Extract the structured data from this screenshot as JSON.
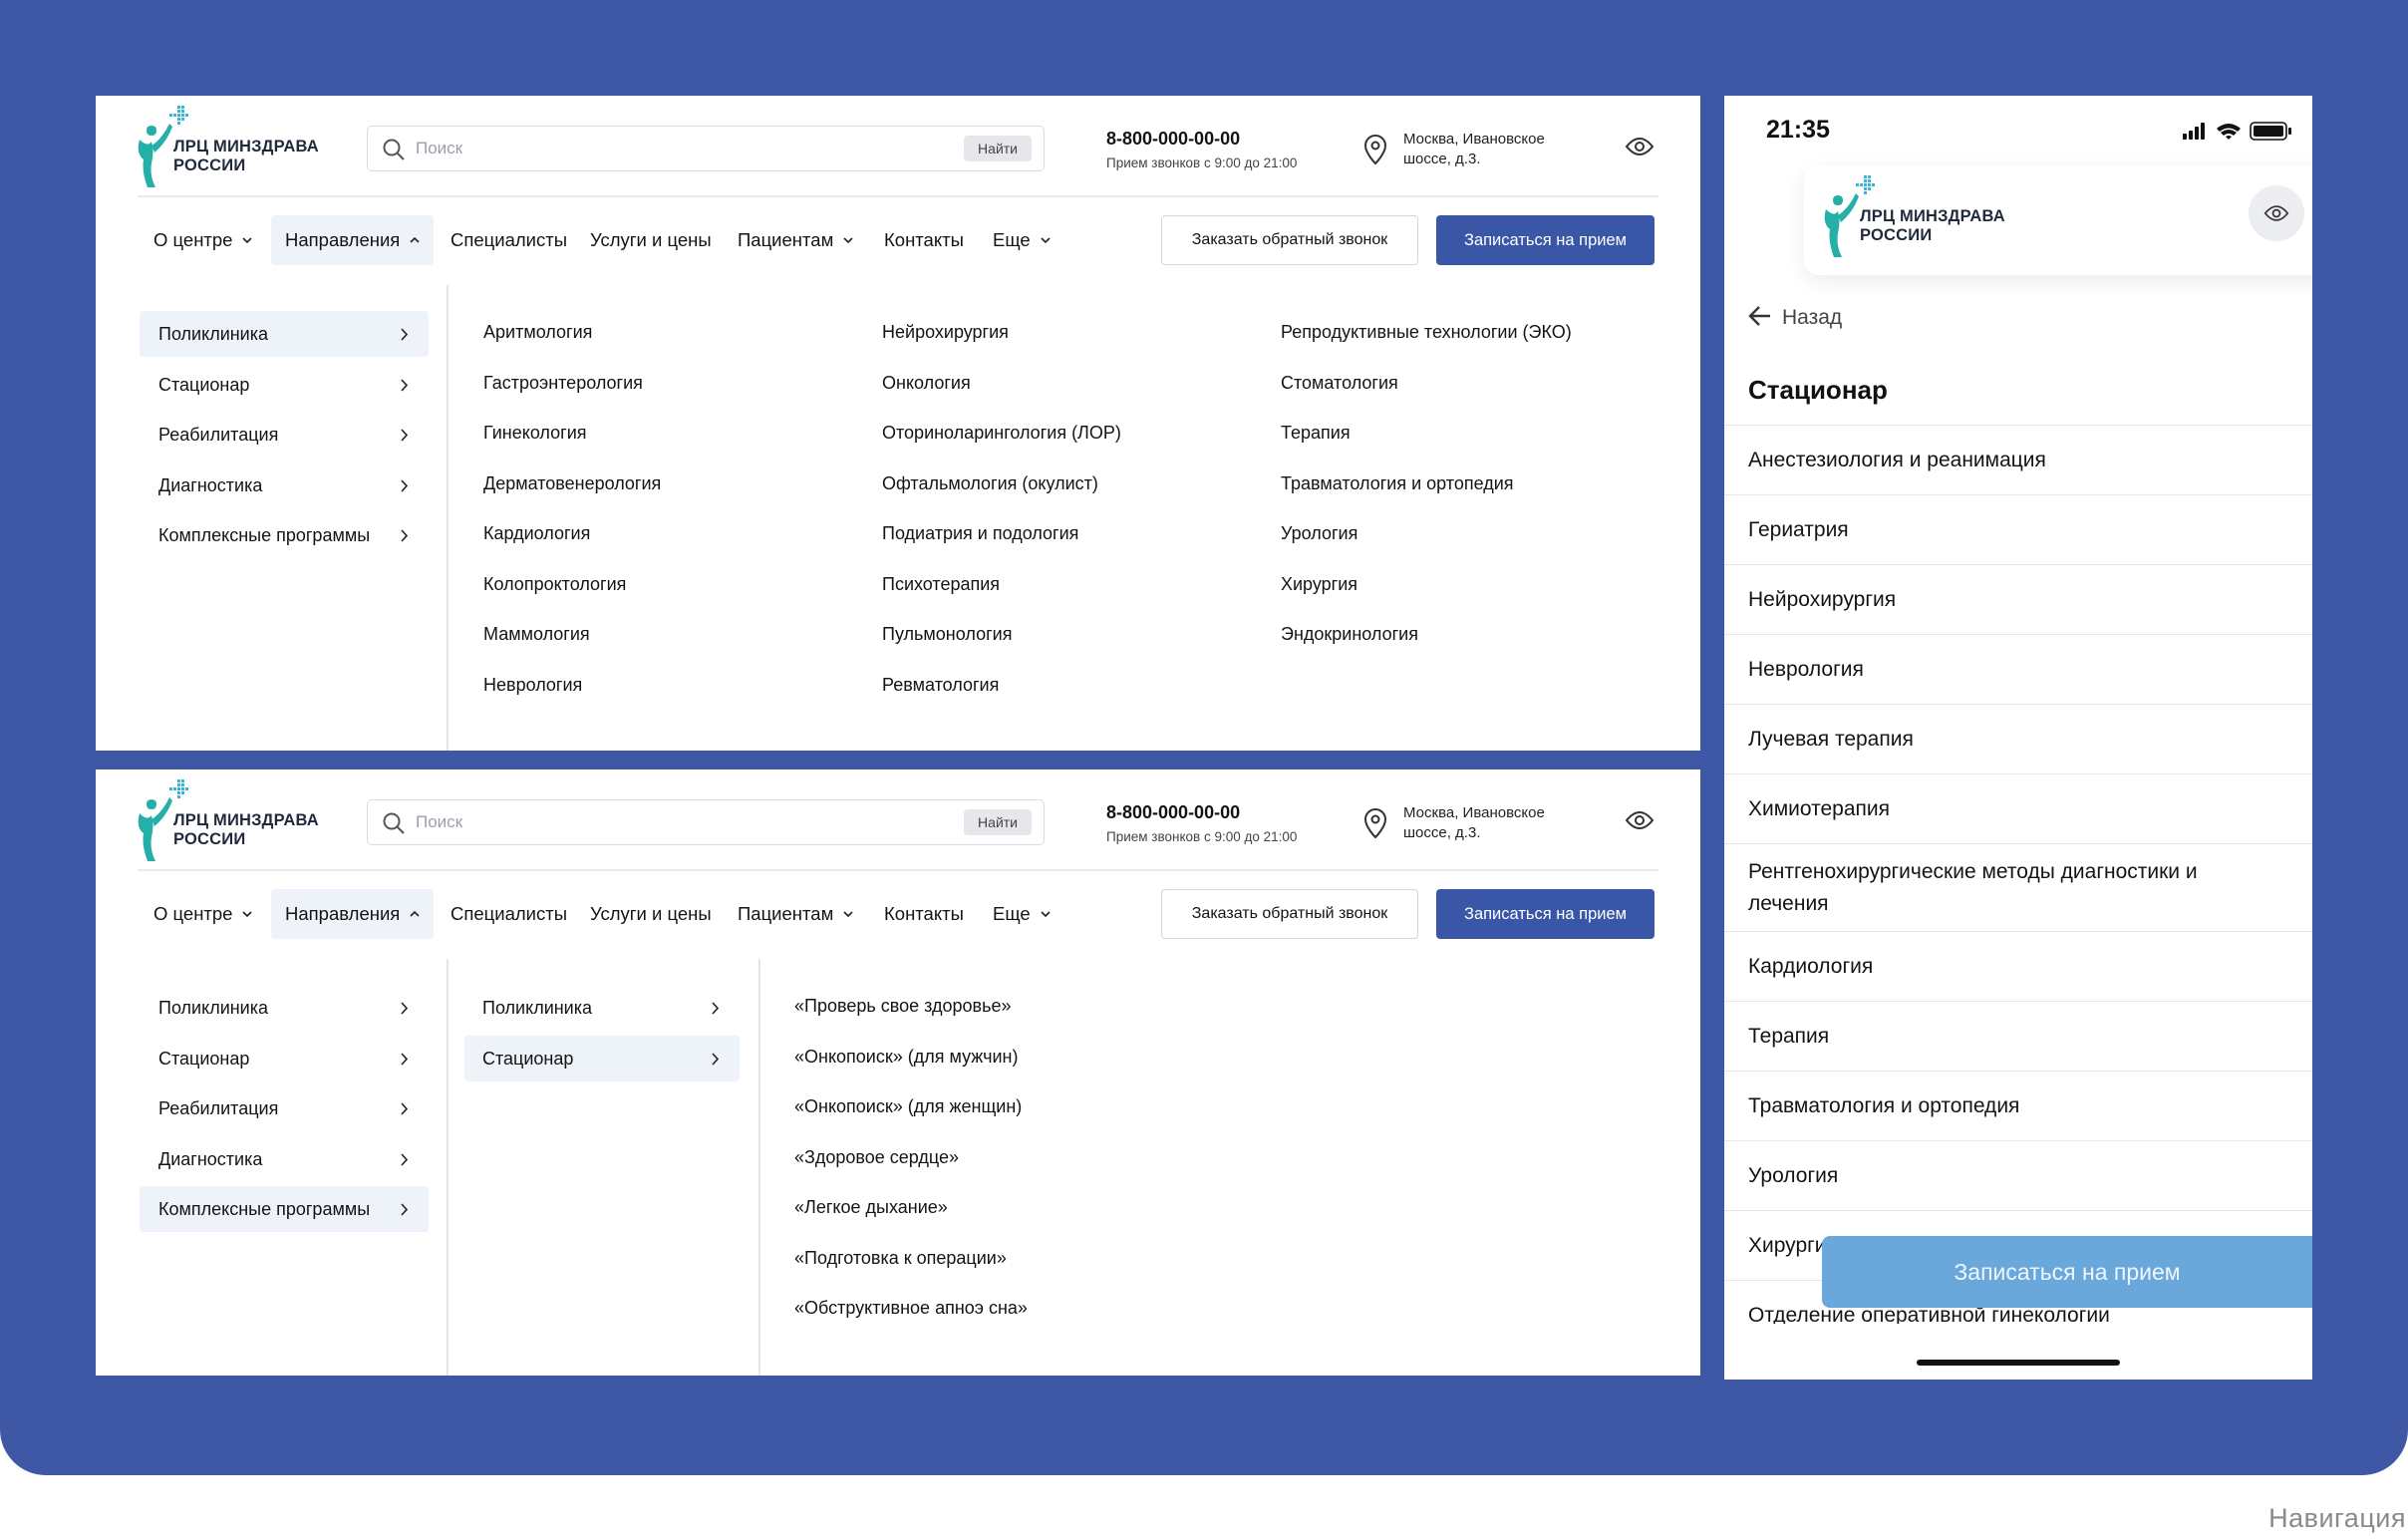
{
  "caption": "Навигация",
  "logo": {
    "line1": "ЛРЦ МИНЗДРАВА",
    "line2": "РОССИИ"
  },
  "search": {
    "placeholder": "Поиск",
    "button": "Найти"
  },
  "contact": {
    "phone": "8-800-000-00-00",
    "hours": "Прием звонков с 9:00 до 21:00",
    "address_line1": "Москва, Ивановское",
    "address_line2": "шоссе, д.3."
  },
  "nav": {
    "items": [
      "О центре",
      "Направления",
      "Специалисты",
      "Услуги и цены",
      "Пациентам",
      "Контакты",
      "Еще"
    ],
    "callback_button": "Заказать обратный звонок",
    "appointment_button": "Записаться на прием"
  },
  "sidebar": [
    "Поликлиника",
    "Стационар",
    "Реабилитация",
    "Диагностика",
    "Комплексные программы"
  ],
  "directions": {
    "col1": [
      "Аритмология",
      "Гастроэнтерология",
      "Гинекология",
      "Дерматовенерология",
      "Кардиология",
      "Колопроктология",
      "Маммология",
      "Неврология"
    ],
    "col2": [
      "Нейрохирургия",
      "Онкология",
      "Оториноларингология (ЛОР)",
      "Офтальмология (окулист)",
      "Подиатрия и подология",
      "Психотерапия",
      "Пульмонология",
      "Ревматология"
    ],
    "col3": [
      "Репродуктивные технологии (ЭКО)",
      "Стоматология",
      "Терапия",
      "Травматология и ортопедия",
      "Урология",
      "Хирургия",
      "Эндокринология"
    ]
  },
  "programs_submenu": [
    "Поликлиника",
    "Стационар"
  ],
  "programs": [
    "«Проверь свое здоровье»",
    "«Онкопоиск» (для мужчин)",
    "«Онкопоиск» (для женщин)",
    "«Здоровое сердце»",
    "«Легкое дыхание»",
    "«Подготовка к операции»",
    "«Обструктивное апноэ сна»"
  ],
  "mobile": {
    "time": "21:35",
    "back": "Назад",
    "title": "Стационар",
    "items": [
      "Анестезиология и реанимация",
      "Гериатрия",
      "Нейрохирургия",
      "Неврология",
      "Лучевая терапия",
      "Химиотерапия",
      "Рентгенохирургические методы диагностики и лечения",
      "Кардиология",
      "Терапия",
      "Травматология и ортопедия",
      "Урология",
      "Хирургия",
      "Отделение оперативной гинекологии"
    ],
    "appointment_button": "Записаться на прием"
  }
}
